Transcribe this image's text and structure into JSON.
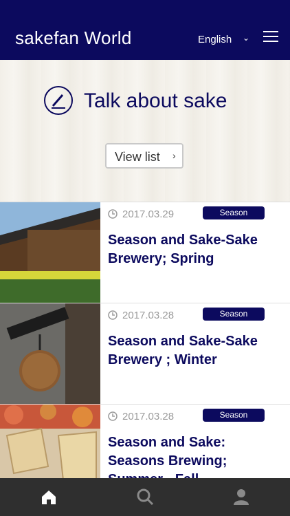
{
  "header": {
    "logo": "sakefan World",
    "language": "English"
  },
  "hero": {
    "title": "Talk about sake",
    "button_label": "View list"
  },
  "articles": [
    {
      "date": "2017.03.29",
      "badge": "Season",
      "title": "Season and Sake-Sake Brewery; Spring"
    },
    {
      "date": "2017.03.28",
      "badge": "Season",
      "title": "Season and Sake-Sake Brewery ; Winter"
    },
    {
      "date": "2017.03.28",
      "badge": "Season",
      "title": "Season and Sake: Seasons Brewing; Summer - Fall"
    }
  ],
  "tabs": [
    {
      "icon": "home-icon"
    },
    {
      "icon": "search-icon"
    },
    {
      "icon": "user-icon"
    }
  ],
  "colors": {
    "brand": "#0c0a5e",
    "tabbar": "#2f2f2f"
  }
}
